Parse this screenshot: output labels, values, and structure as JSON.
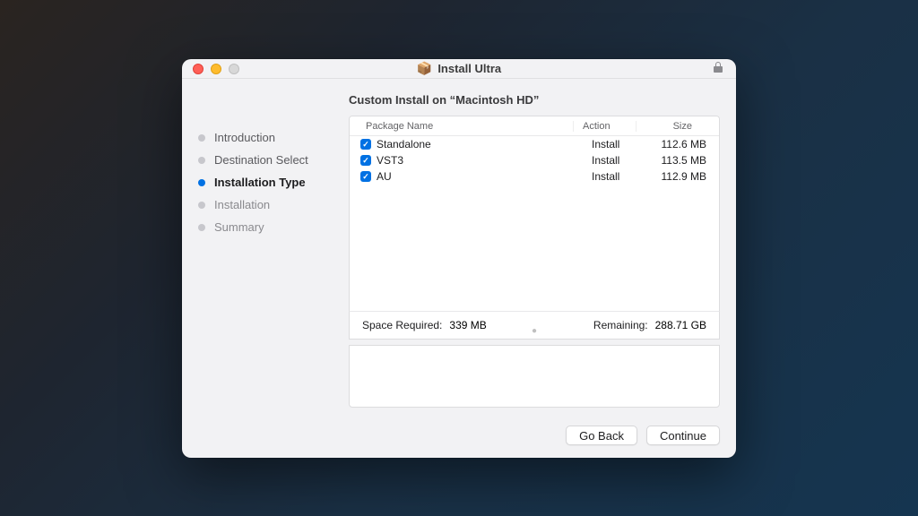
{
  "window": {
    "title": "Install Ultra"
  },
  "sidebar": {
    "steps": [
      {
        "label": "Introduction",
        "state": "done"
      },
      {
        "label": "Destination Select",
        "state": "done"
      },
      {
        "label": "Installation Type",
        "state": "current"
      },
      {
        "label": "Installation",
        "state": "upcoming"
      },
      {
        "label": "Summary",
        "state": "upcoming"
      }
    ]
  },
  "main": {
    "heading": "Custom Install on “Macintosh HD”",
    "columns": {
      "name": "Package Name",
      "action": "Action",
      "size": "Size"
    },
    "packages": [
      {
        "checked": true,
        "name": "Standalone",
        "action": "Install",
        "size": "112.6 MB"
      },
      {
        "checked": true,
        "name": "VST3",
        "action": "Install",
        "size": "113.5 MB"
      },
      {
        "checked": true,
        "name": "AU",
        "action": "Install",
        "size": "112.9 MB"
      }
    ],
    "status": {
      "space_required_label": "Space Required:",
      "space_required_value": "339 MB",
      "remaining_label": "Remaining:",
      "remaining_value": "288.71 GB"
    }
  },
  "buttons": {
    "go_back": "Go Back",
    "continue": "Continue"
  }
}
